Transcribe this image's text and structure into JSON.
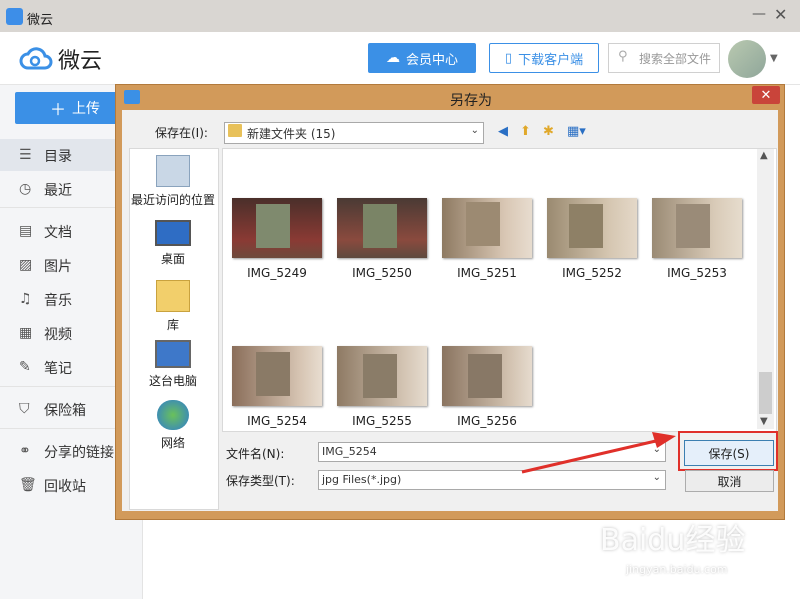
{
  "app": {
    "title": "微云",
    "logo_text": "微云",
    "minimize": "—",
    "close": "✕"
  },
  "header": {
    "vip_label": "会员中心",
    "download_label": "下载客户端",
    "search_placeholder": "搜索全部文件"
  },
  "sidebar": {
    "upload_label": "上传",
    "items": [
      {
        "icon": "list-icon",
        "label": "目录"
      },
      {
        "icon": "clock-icon",
        "label": "最近"
      },
      {
        "icon": "document-icon",
        "label": "文档"
      },
      {
        "icon": "image-icon",
        "label": "图片"
      },
      {
        "icon": "music-icon",
        "label": "音乐"
      },
      {
        "icon": "video-icon",
        "label": "视频"
      },
      {
        "icon": "note-icon",
        "label": "笔记"
      },
      {
        "icon": "shield-icon",
        "label": "保险箱"
      },
      {
        "icon": "share-link-icon",
        "label": "分享的链接"
      },
      {
        "icon": "trash-icon",
        "label": "回收站"
      }
    ]
  },
  "dialog": {
    "title": "另存为",
    "close": "✕",
    "save_in_label": "保存在(I):",
    "save_in_value": "新建文件夹 (15)",
    "places": [
      {
        "icon": "recent-places-icon",
        "label": "最近访问的位置"
      },
      {
        "icon": "desktop-icon",
        "label": "桌面"
      },
      {
        "icon": "library-icon",
        "label": "库"
      },
      {
        "icon": "computer-icon",
        "label": "这台电脑"
      },
      {
        "icon": "network-icon",
        "label": "网络"
      }
    ],
    "files": [
      {
        "name": "IMG_5249"
      },
      {
        "name": "IMG_5250"
      },
      {
        "name": "IMG_5251"
      },
      {
        "name": "IMG_5252"
      },
      {
        "name": "IMG_5253"
      },
      {
        "name": "IMG_5254"
      },
      {
        "name": "IMG_5255"
      },
      {
        "name": "IMG_5256"
      }
    ],
    "filename_label": "文件名(N):",
    "filename_value": "IMG_5254",
    "filetype_label": "保存类型(T):",
    "filetype_value": "jpg Files(*.jpg)",
    "save_label": "保存(S)",
    "cancel_label": "取消"
  },
  "watermark": {
    "text": "Baidu经验",
    "sub": "jingyan.baidu.com"
  },
  "colors": {
    "accent": "#3b90e6",
    "dialog_frame": "#d29a5a",
    "highlight": "#e0302a"
  }
}
